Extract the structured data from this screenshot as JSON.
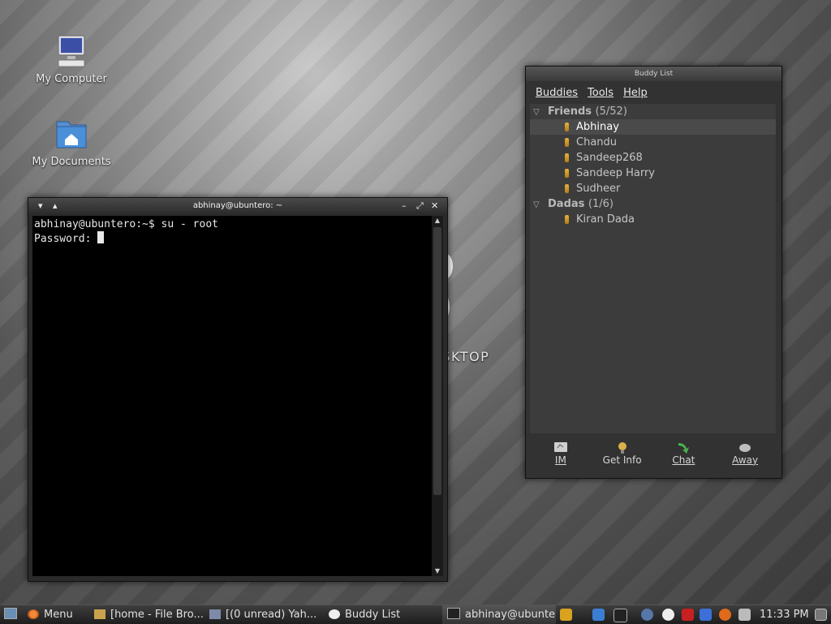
{
  "desktop": {
    "icons": [
      {
        "label": "My Computer"
      },
      {
        "label": "My Documents"
      }
    ],
    "wallpaper_text": "GNOME DESKTOP"
  },
  "terminal": {
    "title": "abhinay@ubuntero: ~",
    "lines": [
      "abhinay@ubuntero:~$ su - root",
      "Password: "
    ]
  },
  "buddy_list": {
    "title": "Buddy List",
    "menu": [
      "Buddies",
      "Tools",
      "Help"
    ],
    "groups": [
      {
        "name": "Friends",
        "count": "(5/52)",
        "buddies": [
          "Abhinay",
          "Chandu",
          "Sandeep268",
          "Sandeep Harry",
          "Sudheer"
        ]
      },
      {
        "name": "Dadas",
        "count": "(1/6)",
        "buddies": [
          "Kiran Dada"
        ]
      }
    ],
    "buttons": [
      "IM",
      "Get Info",
      "Chat",
      "Away"
    ]
  },
  "taskbar": {
    "menu_label": "Menu",
    "tasks": [
      "[home - File Bro...",
      "[(0 unread) Yah...",
      "Buddy List",
      "abhinay@ubunter..."
    ],
    "clock": "11:33 PM"
  },
  "colors": {
    "accent_folder": "#4a90d9",
    "buddy_icon": "#e8b23a"
  }
}
